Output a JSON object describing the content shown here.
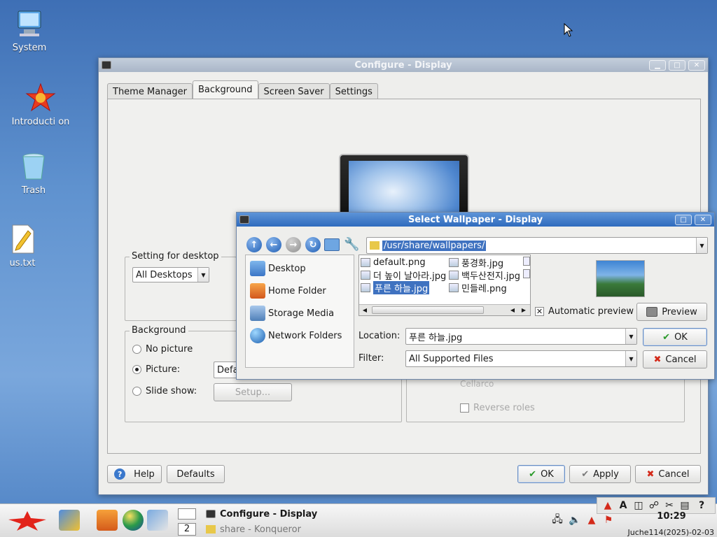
{
  "desktop": {
    "icons": [
      {
        "label": "System"
      },
      {
        "label": "Introducti on"
      },
      {
        "label": "Trash"
      },
      {
        "label": "us.txt"
      }
    ]
  },
  "main_window": {
    "title": "Configure - Display",
    "tabs": [
      "Theme Manager",
      "Background",
      "Screen Saver",
      "Settings"
    ],
    "setting_group": {
      "title": "Setting for desktop",
      "combo_value": "All Desktops"
    },
    "background_group": {
      "title": "Background",
      "options": [
        "No picture",
        "Picture:",
        "Slide show:"
      ],
      "picture_value": "Defa",
      "setup_label": "Setup..."
    },
    "reverse_roles_label": "Reverse roles",
    "hidden_text": "Cellarco",
    "buttons": {
      "help": "Help",
      "defaults": "Defaults",
      "ok": "OK",
      "apply": "Apply",
      "cancel": "Cancel"
    }
  },
  "dialog": {
    "title": "Select Wallpaper - Display",
    "path": "/usr/share/wallpapers/",
    "places": [
      "Desktop",
      "Home Folder",
      "Storage Media",
      "Network Folders"
    ],
    "files": [
      "default.png",
      "더 높이 날아라.jpg",
      "푸른 하늘.jpg",
      "풍경화.jpg",
      "백두산전지.jpg",
      "민들레.png"
    ],
    "selected_file": "푸른 하늘.jpg",
    "auto_preview_label": "Automatic preview",
    "preview_button": "Preview",
    "location_label": "Location:",
    "location_value": "푸른 하늘.jpg",
    "filter_label": "Filter:",
    "filter_value": "All Supported Files",
    "ok_button": "OK",
    "cancel_button": "Cancel"
  },
  "taskbar": {
    "desktop_number": "2",
    "tasks": [
      "Configure - Display",
      "share - Konqueror"
    ],
    "clock_time": "10:29",
    "clock_date": "Juche114(2025)-02-03"
  },
  "colors": {
    "accent": "#2f6bbd",
    "selection": "#3f72c0"
  }
}
